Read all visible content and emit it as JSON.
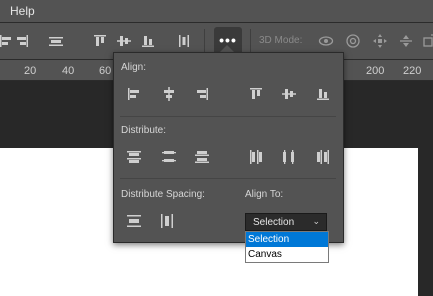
{
  "menubar": {
    "help_label": "Help"
  },
  "options_bar": {
    "more_label": "•••",
    "mode3d_label": "3D Mode:",
    "icons": [
      "align-left-icon",
      "align-center-icon",
      "align-right-icon",
      "align-top-icon",
      "align-middle-icon",
      "align-bottom-icon",
      "distribute-icon",
      "orbit-icon",
      "roll-icon",
      "pan-icon",
      "slide-icon",
      "scale-icon"
    ]
  },
  "ruler": {
    "labels": [
      "20",
      "40",
      "60",
      "200",
      "220"
    ]
  },
  "align_panel": {
    "align_label": "Align:",
    "distribute_label": "Distribute:",
    "distribute_spacing_label": "Distribute Spacing:",
    "align_to_label": "Align To:",
    "align_to_value": "Selection",
    "align_to_options": [
      "Selection",
      "Canvas"
    ]
  },
  "colors": {
    "panel": "#535353",
    "workspace": "#282828",
    "selected": "#0078d7"
  }
}
